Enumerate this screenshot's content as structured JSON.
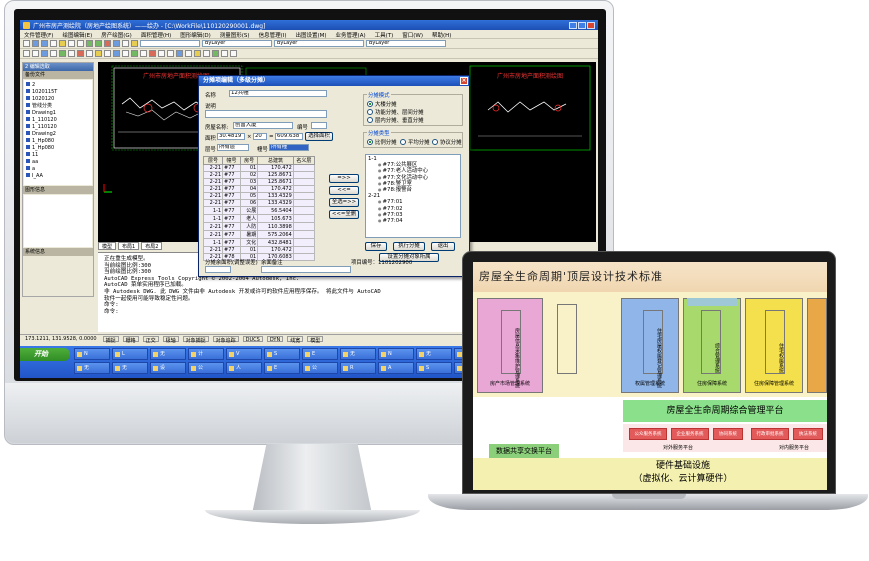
{
  "cad_window": {
    "title": "广州市房产测绘院（房地产绘图系统）——绘办 - [C:\\WorkFile\\110120290001.dwg]",
    "menu": [
      "文件管理(F)",
      "绘图编辑(E)",
      "房产绘图(G)",
      "面积管理(H)",
      "图形编辑(D)",
      "测量图形(S)",
      "信息管理(I)",
      "出图设置(M)",
      "业务管理(A)",
      "工具(T)",
      "窗口(W)",
      "帮助(H)"
    ],
    "layer_combo": "ByLayer",
    "left_panel": {
      "header": "2 编辑选取",
      "section_files": "备份文件",
      "tree": [
        "2",
        "1020115T",
        "1020120",
        "管线分类",
        "Drawing1",
        "1_110120",
        "1_110120",
        "Drawing2",
        "1_Hp080",
        "1_Hp080",
        "11",
        "aa",
        "a",
        "I_AA"
      ],
      "section_props": "图形信息",
      "section_extra": "系统信息"
    },
    "drawing": {
      "left_title": "广州市房地产面积测绘图",
      "right_title": "广州市房地产面积测绘图"
    },
    "drawing_tabs": [
      "模型",
      "布局1",
      "布局2"
    ],
    "command_lines": [
      "正在重生成模型。",
      "当前绘图比例:300",
      "当前绘图比例:300",
      "AutoCAD Express Tools Copyright © 2002-2004 Autodesk, Inc.",
      "AutoCAD 菜单实用程序已加载。",
      "非 Autodesk DWG.  此 DWG 文件由非 Autodesk 开发或许可的软件应用程序保存。  将此文件与 AutoCAD",
      "软件一起使用可能导致稳定性问题。",
      "命令:",
      "命令:"
    ],
    "status": {
      "coords": "173.1211, 131.9528, 0.0000",
      "toggles": [
        "捕捉",
        "栅格",
        "正交",
        "极轴",
        "对象捕捉",
        "对象追踪",
        "DUCS",
        "DYN",
        "线宽",
        "模型"
      ]
    },
    "taskbar": {
      "start": "开始",
      "items": [
        "N",
        "L",
        "无",
        "计",
        "V",
        "S",
        "E",
        "无",
        "N",
        "无",
        "无",
        "A",
        "计",
        "无",
        "无",
        "设",
        "公",
        "人",
        "E",
        "公",
        "R",
        "A",
        "S",
        "计",
        "无",
        "C"
      ]
    }
  },
  "dialog": {
    "title": "分摊项编辑（多级分摊）",
    "name_label": "名称",
    "name_value": "12共幢",
    "desc_label": "说明",
    "building_label": "房屋名称:",
    "building_value": "创富大厦",
    "number_label": "编号",
    "area_label": "面积",
    "area_a": "30.4819",
    "area_x": "×",
    "area_b": "20",
    "area_eq": "=",
    "area_result": "609.638",
    "select_area_button": "选择面积",
    "floor_label": "层号",
    "floor_value": "所有层",
    "code_label": "幢号",
    "code_value": "所有幢",
    "table": {
      "headers": [
        "层号",
        "幢号",
        "房号",
        "总建筑",
        "名义层"
      ],
      "rows": [
        [
          "2-21",
          "#77",
          "01",
          "170.472",
          ""
        ],
        [
          "2-21",
          "#77",
          "02",
          "125.8671",
          ""
        ],
        [
          "2-21",
          "#77",
          "03",
          "125.8671",
          ""
        ],
        [
          "2-21",
          "#77",
          "04",
          "170.472",
          ""
        ],
        [
          "2-21",
          "#77",
          "05",
          "133.4329",
          ""
        ],
        [
          "2-21",
          "#77",
          "06",
          "133.4329",
          ""
        ],
        [
          "1-1",
          "#77",
          "公展",
          "56.5404",
          ""
        ],
        [
          "1-1",
          "#77",
          "老人",
          "105.673",
          ""
        ],
        [
          "2-21",
          "#77",
          "人防",
          "110.3898",
          ""
        ],
        [
          "2-21",
          "#77",
          "暑期",
          "575.2064",
          ""
        ],
        [
          "1-1",
          "#77",
          "文化",
          "432.8481",
          ""
        ],
        [
          "2-21",
          "#77",
          "01",
          "170.472",
          ""
        ],
        [
          "2-21",
          "#78",
          "01",
          "170.6083",
          ""
        ]
      ]
    },
    "btn_add": "=>>",
    "btn_remove": "<<=",
    "btn_add_all": "全选=>>",
    "btn_remove_all": "<<=全删",
    "method_group": "分摊模式",
    "methods": [
      "大楼分摊",
      "功能分摊、层间分摊",
      "层内分摊、垂直分摊"
    ],
    "type_group": "分摊类型",
    "types": [
      "比例分摊",
      "平均分摊",
      "协议分摊"
    ],
    "right_list": [
      "1-1",
      "#77:公共展区",
      "#77:老人活动中心",
      "#77:文化活动中心",
      "#78:警卫室",
      "#78:报警台",
      "2-21",
      "#77:01",
      "#77:02",
      "#77:03",
      "#77:04"
    ],
    "right_list_levels": [
      1,
      2,
      2,
      2,
      2,
      2,
      1,
      2,
      2,
      2,
      2
    ],
    "btn_save": "保存",
    "btn_exec": "执行分摊",
    "btn_exit": "退出",
    "btn_set_object": "设置分摊对象所属",
    "remaining_label": "分摊余面积(调整误差)",
    "remaining_note": "余面备注",
    "project_no": "项目编号：1101202900"
  },
  "laptop": {
    "title": "房屋全生命周期'顶层设计技术标准",
    "columns": [
      {
        "text": "房屋信息采集维护管理系统",
        "foot": "房产市场管理系统",
        "color": "#e9a7d6"
      },
      {
        "text": "住宅房屋权属登记管理系统",
        "foot": "权属管理系统",
        "color": "#8fb5e9"
      },
      {
        "text": "综合管理系统",
        "foot": "住房保障系统",
        "color": "#a7d96c"
      },
      {
        "text": "住宅权属系统",
        "foot": "住房保障管理系统",
        "color": "#f4e04d"
      }
    ],
    "platform": "房屋全生命周期综合管理平台",
    "services_label": "对外服务平台",
    "services_label_2": "对内服务平台",
    "service_boxes": [
      "公众服务系统",
      "企业服务系统",
      "协同系统",
      "行政审批系统",
      "执法系统"
    ],
    "data_platform": "数据共享交换平台",
    "infra_line1": "硬件基础设施",
    "infra_line2": "（虚拟化、云计算硬件）"
  }
}
